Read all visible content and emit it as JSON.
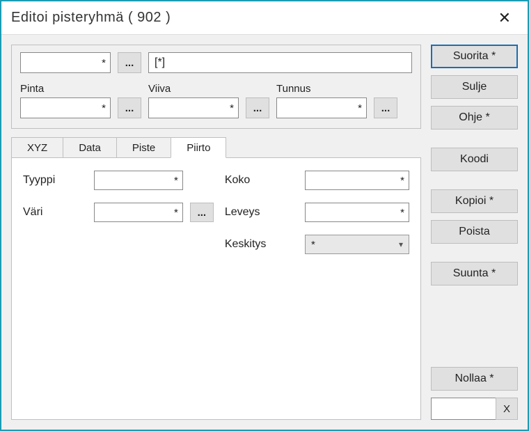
{
  "window": {
    "title": "Editoi pisteryhmä  ( 902 )",
    "close_glyph": "✕"
  },
  "top": {
    "first_input": "*",
    "dots": "...",
    "long_input": "[*]",
    "pinta_label": "Pinta",
    "pinta_value": "*",
    "viiva_label": "Viiva",
    "viiva_value": "*",
    "tunnus_label": "Tunnus",
    "tunnus_value": "*"
  },
  "tabs": {
    "xyz": "XYZ",
    "data": "Data",
    "piste": "Piste",
    "piirto": "Piirto"
  },
  "form": {
    "tyyppi_label": "Tyyppi",
    "tyyppi_value": "*",
    "vari_label": "Väri",
    "vari_value": "*",
    "koko_label": "Koko",
    "koko_value": "*",
    "leveys_label": "Leveys",
    "leveys_value": "*",
    "keskitys_label": "Keskitys",
    "keskitys_value": "*"
  },
  "buttons": {
    "suorita": "Suorita *",
    "sulje": "Sulje",
    "ohje": "Ohje *",
    "koodi": "Koodi",
    "kopioi": "Kopioi *",
    "poista": "Poista",
    "suunta": "Suunta *",
    "nollaa": "Nollaa *",
    "x": "X"
  }
}
